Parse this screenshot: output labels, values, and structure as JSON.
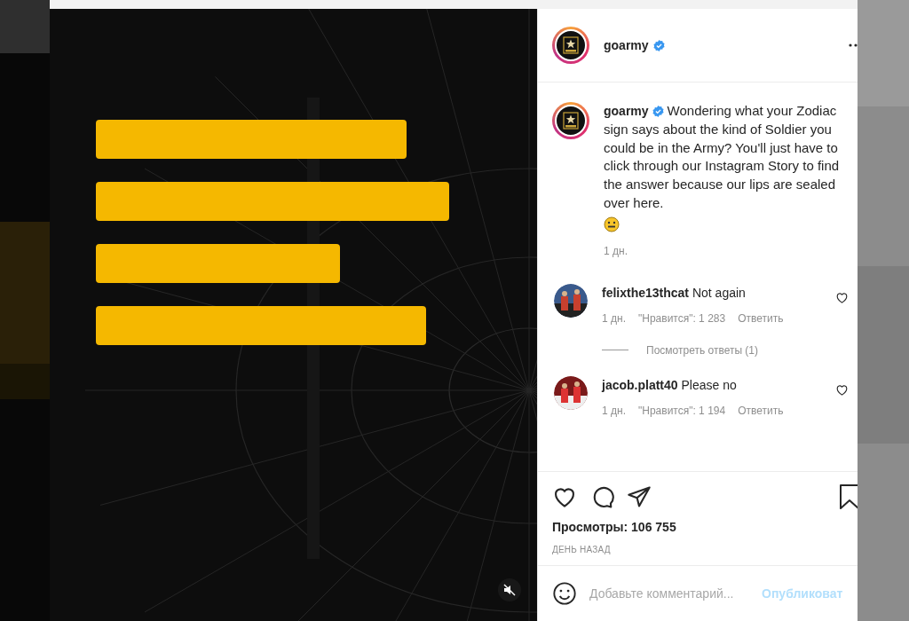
{
  "post": {
    "media": {
      "kind": "picture",
      "muted": true
    },
    "author": {
      "username": "goarmy",
      "verified": true
    },
    "caption": {
      "username": "goarmy",
      "verified": true,
      "text": "Wondering what your Zodiac sign says about the kind of Soldier you could be in the Army? You'll just have to click through our Instagram Story to find the answer because our lips are sealed over here.",
      "time": "1 дн."
    },
    "comments": [
      {
        "username": "felixthe13thcat",
        "text": "Not again",
        "time": "1 дн.",
        "likes": "\"Нравится\": 1 283",
        "reply": "Ответить",
        "liked": false,
        "view_replies": "Посмотреть ответы (1)"
      },
      {
        "username": "jacob.platt40",
        "text": "Please no",
        "time": "1 дн.",
        "likes": "\"Нравится\": 1 194",
        "reply": "Ответить",
        "liked": false
      }
    ],
    "views": "Просмотры: 106 755",
    "date": "ДЕНЬ НАЗАД",
    "comment_field": {
      "placeholder": "Добавьте комментарий...",
      "post_button": "Опубликоват"
    }
  }
}
